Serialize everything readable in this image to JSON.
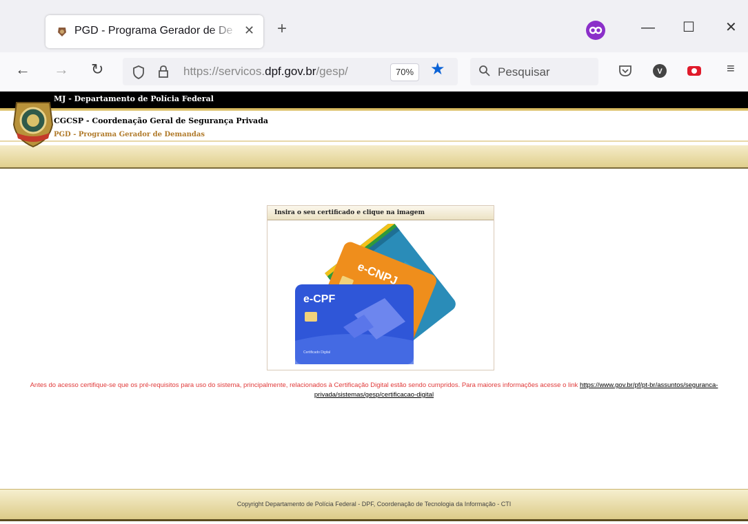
{
  "browser": {
    "tab": {
      "title": "PGD - Programa Gerador de De"
    },
    "url": {
      "prefix": "https://servicos.",
      "domain": "dpf.gov.br",
      "path": "/gesp/"
    },
    "zoom": "70%",
    "search_placeholder": "Pesquisar"
  },
  "banner": {
    "ministry": "MJ - Departamento de Polícia Federal",
    "department": "CGCSP - Coordenação Geral de Segurança Privada",
    "program": "PGD - Programa Gerador de Demandas"
  },
  "login": {
    "header": "Insira o seu certificado e clique na imagem",
    "card_cnpj": "e-CNPJ",
    "card_cpf": "e-CPF",
    "card_caption": "Certificado Digital"
  },
  "notice": {
    "text": "Antes do acesso certifique-se que os pré-requisitos para uso do sistema, principalmente, relacionados à Certificação Digital estão sendo cumpridos. Para maiores informações acesse o link ",
    "link": "https://www.gov.br/pf/pt-br/assuntos/seguranca-privada/sistemas/gesp/certificacao-digital"
  },
  "footer": {
    "text": "Copyright Departamento de Polícia Federal - DPF, Coordenação de Tecnologia da Informação - CTI"
  },
  "colors": {
    "notice": "#e03a3a",
    "gold": "#e0cf8d",
    "url_accent": "#0a62d6"
  }
}
